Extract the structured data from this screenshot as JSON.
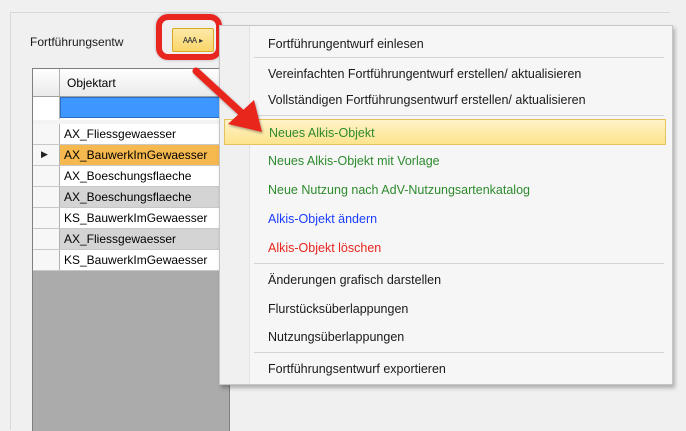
{
  "window": {
    "label": "Fortführungsentw",
    "tool_icon": "ᴀᴀᴀ",
    "tool_arrow": "▸"
  },
  "grid": {
    "column_header": "Objektart",
    "rows": [
      {
        "text": "AX_Fliessgewaesser",
        "style": "white",
        "pointer": ""
      },
      {
        "text": "AX_BauwerkImGewaesser",
        "style": "sel",
        "pointer": "▶"
      },
      {
        "text": "AX_Boeschungsflaeche",
        "style": "white",
        "pointer": ""
      },
      {
        "text": "AX_Boeschungsflaeche",
        "style": "grey",
        "pointer": ""
      },
      {
        "text": "KS_BauwerkImGewaesser",
        "style": "white",
        "pointer": ""
      },
      {
        "text": "AX_Fliessgewaesser",
        "style": "grey",
        "pointer": ""
      },
      {
        "text": "KS_BauwerkImGewaesser",
        "style": "white",
        "pointer": ""
      }
    ]
  },
  "menu": {
    "items": [
      {
        "label": "Fortführungentwurf einlesen",
        "color": "#1a1a1a"
      },
      {
        "label": "Vereinfachten Fortführungentwurf erstellen/ aktualisieren",
        "color": "#1a1a1a"
      },
      {
        "label": "Vollständigen Fortführungsentwurf erstellen/ aktualisieren",
        "color": "#1a1a1a"
      },
      {
        "label": "Neues Alkis-Objekt",
        "color": "#2e8b2e"
      },
      {
        "label": "Neues Alkis-Objekt mit Vorlage",
        "color": "#2e8b2e"
      },
      {
        "label": "Neue Nutzung nach AdV-Nutzungsartenkatalog",
        "color": "#2e8b2e"
      },
      {
        "label": "Alkis-Objekt ändern",
        "color": "#1a3cff"
      },
      {
        "label": "Alkis-Objekt löschen",
        "color": "#e8251f"
      },
      {
        "label": "Änderungen grafisch darstellen",
        "color": "#1a1a1a"
      },
      {
        "label": "Flurstücksüberlappungen",
        "color": "#1a1a1a"
      },
      {
        "label": "Nutzungsüberlappungen",
        "color": "#1a1a1a"
      },
      {
        "label": "Fortführungsentwurf exportieren",
        "color": "#1a1a1a"
      }
    ],
    "highlighted_index": 3
  },
  "colors": {
    "highlight_annotation": "#e8251f",
    "selected_row": "#f6b94f",
    "filter_cell": "#3d97ff"
  }
}
